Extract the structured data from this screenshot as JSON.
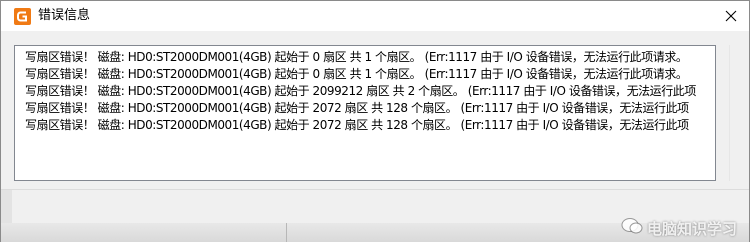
{
  "window": {
    "title": "错误信息",
    "icon": "app-logo-icon",
    "close_icon": "close-icon"
  },
  "log": {
    "lines": [
      "写扇区错误！ 磁盘: HD0:ST2000DM001(4GB) 起始于 0 扇区 共 1 个扇区。 (Err:1117 由于 I/O 设备错误，无法运行此项请求。",
      "写扇区错误！ 磁盘: HD0:ST2000DM001(4GB) 起始于 0 扇区 共 1 个扇区。 (Err:1117 由于 I/O 设备错误，无法运行此项请求。",
      "写扇区错误！ 磁盘: HD0:ST2000DM001(4GB) 起始于 2099212 扇区 共 2 个扇区。 (Err:1117 由于 I/O 设备错误，无法运行此项",
      "写扇区错误！ 磁盘: HD0:ST2000DM001(4GB) 起始于 2072 扇区 共 128 个扇区。 (Err:1117 由于 I/O 设备错误，无法运行此项",
      "写扇区错误！ 磁盘: HD0:ST2000DM001(4GB) 起始于 2072 扇区 共 128 个扇区。 (Err:1117 由于 I/O 设备错误，无法运行此项"
    ]
  },
  "watermark": {
    "text": "电脑知识学习"
  },
  "colors": {
    "icon_orange": "#f07a14",
    "panel_border": "#828790",
    "window_bg": "#f0f0f0"
  }
}
